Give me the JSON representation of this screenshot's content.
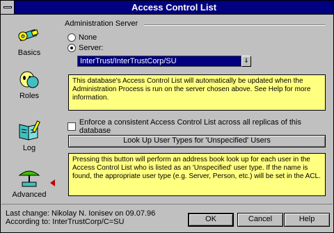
{
  "window": {
    "title": "Access Control List"
  },
  "sidebar": {
    "items": [
      {
        "label": "Basics",
        "icon": "key-icon"
      },
      {
        "label": "Roles",
        "icon": "roles-icon"
      },
      {
        "label": "Log",
        "icon": "log-book-icon"
      },
      {
        "label": "Advanced",
        "icon": "advanced-icon"
      }
    ],
    "active": "Advanced"
  },
  "admin_server": {
    "group_label": "Administration Server",
    "option_none": "None",
    "option_server": "Server:",
    "selected": "Server:",
    "server_value": "InterTrust/InterTrustCorp/SU",
    "dropdown_glyph": "⇓"
  },
  "notes": {
    "update_note": "This database's Access Control List will automatically be updated when the Administration Process is run on the server chosen above. See Help for more information.",
    "lookup_note": "Pressing this button will perform an address book look up for each user in the Access Control List who is listed as an 'Unspecified' user type.  If the name is found, the appropriate user type (e.g. Server, Person, etc.) will be set in the ACL."
  },
  "consistency": {
    "label": "Enforce a consistent Access Control List across all replicas of this database",
    "checked": false
  },
  "lookup_button": {
    "label": "Look Up User Types for 'Unspecified' Users"
  },
  "footer": {
    "last_change": "Last change: Nikolay N. Ionisev on 09.07.96",
    "according_to": "According to: InterTrustCorp/C=SU",
    "ok_label": "OK",
    "cancel_label": "Cancel",
    "help_label": "Help"
  },
  "colors": {
    "title_bar": "#000080",
    "note_bg": "#ffff80",
    "window_bg": "#c0c0c0",
    "marker": "#c00000"
  }
}
